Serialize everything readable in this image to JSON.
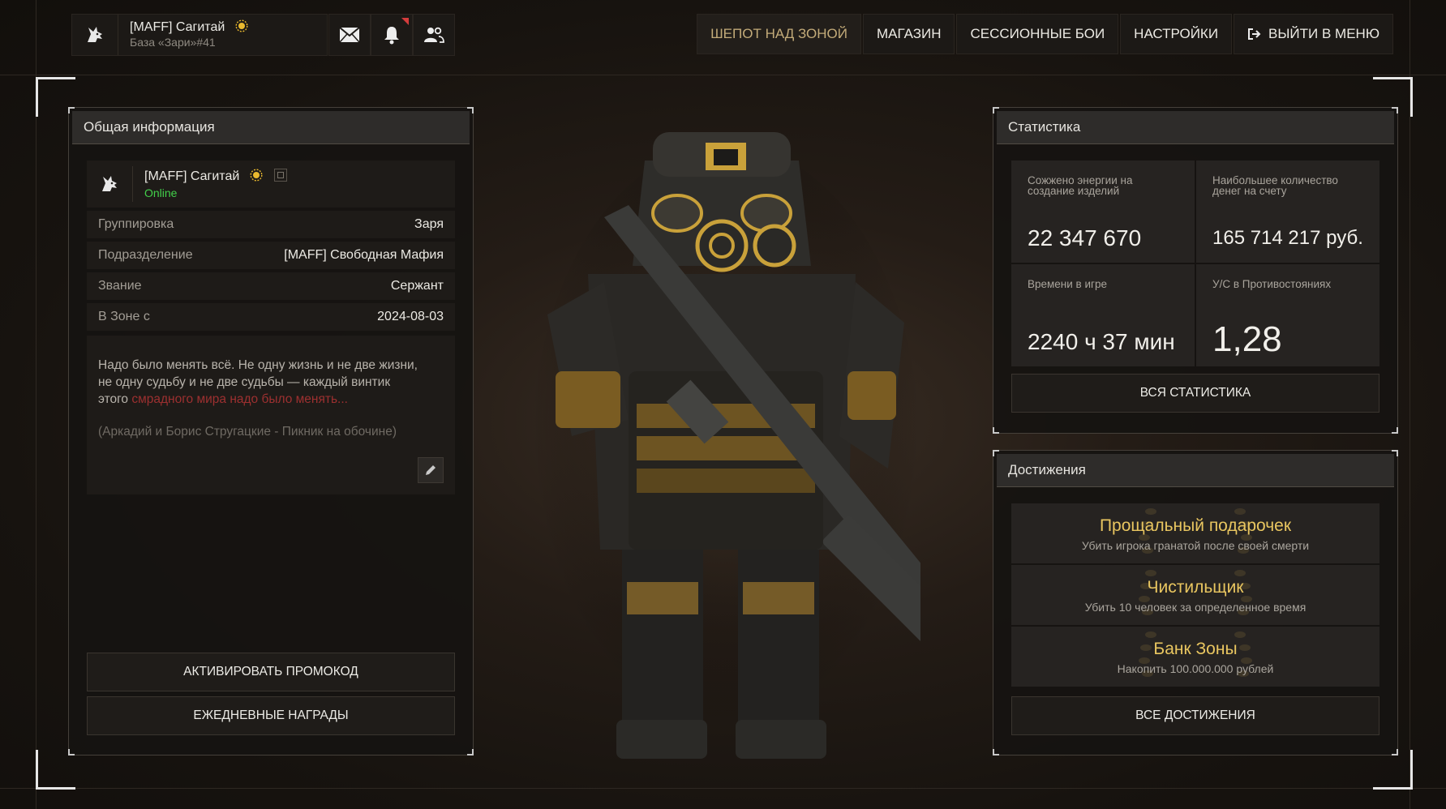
{
  "profile": {
    "name": "[MAFF] Сагитай",
    "base": "База «Зари»#41"
  },
  "top_icons": [
    "mail-icon",
    "bell-icon",
    "friends-icon"
  ],
  "nav": {
    "items": [
      "ШЕПОТ НАД ЗОНОЙ",
      "МАГАЗИН",
      "СЕССИОННЫЕ БОИ",
      "НАСТРОЙКИ",
      "ВЫЙТИ В МЕНЮ"
    ],
    "active": "ШЕПОТ НАД ЗОНОЙ"
  },
  "general": {
    "title": "Общая информация",
    "user_name": "[MAFF] Сагитай",
    "status": "Online",
    "rows": [
      {
        "label": "Группировка",
        "value": "Заря"
      },
      {
        "label": "Подразделение",
        "value": "[MAFF] Свободная Мафия"
      },
      {
        "label": "Звание",
        "value": "Сержант"
      },
      {
        "label": "В Зоне с",
        "value": "2024-08-03"
      }
    ],
    "quote_line1": "Надо было менять всё. Не одну жизнь и не две жизни,",
    "quote_line2": "не одну судьбу и не две судьбы — каждый винтик",
    "quote_line3_a": "этого ",
    "quote_line3_b": "смрадного мира надо было менять...",
    "quote_author": "(Аркадий и Борис Стругацкие - Пикник на обочине)",
    "promo_button": "АКТИВИРОВАТЬ ПРОМОКОД",
    "daily_button": "ЕЖЕДНЕВНЫЕ НАГРАДЫ"
  },
  "stats": {
    "title": "Статистика",
    "cells": [
      {
        "label": "Сожжено энергии на создание изделий",
        "value": "22 347 670"
      },
      {
        "label": "Наибольшее количество денег на счету",
        "value": "165 714 217 руб."
      },
      {
        "label": "Времени в игре",
        "value": "2240 ч 37 мин"
      },
      {
        "label": "У/С в Противостояниях",
        "value": "1,28"
      }
    ],
    "all_button": "ВСЯ СТАТИСТИКА"
  },
  "achievements": {
    "title": "Достижения",
    "items": [
      {
        "title": "Прощальный подарочек",
        "desc": "Убить игрока гранатой после своей смерти"
      },
      {
        "title": "Чистильщик",
        "desc": "Убить 10 человек за определенное время"
      },
      {
        "title": "Банк Зоны",
        "desc": "Накопить 100.000.000 рублей"
      }
    ],
    "all_button": "ВСЕ ДОСТИЖЕНИЯ"
  },
  "colors": {
    "accent_gold": "#e9c660",
    "nav_active": "#c3ab79",
    "online_green": "#42d04a",
    "quote_red": "#9d3030"
  }
}
